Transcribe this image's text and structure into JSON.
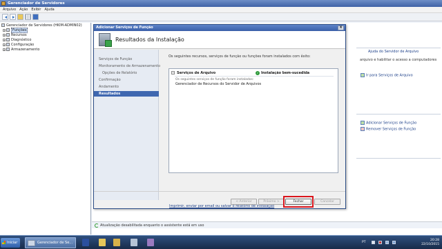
{
  "window": {
    "title": "Gerenciador de Servidores",
    "menu": [
      "Arquivo",
      "Ação",
      "Exibir",
      "Ajuda"
    ]
  },
  "tree": {
    "root": "Gerenciador de Servidores (HKIM-ADMIN02)",
    "items": [
      "Funções",
      "Recursos",
      "Diagnóstico",
      "Configuração",
      "Armazenamento"
    ]
  },
  "right_pane": {
    "help_link": "Ajuda do Servidor de Arquivo",
    "description": "arquivo e habilitar o acesso a computadores",
    "goto_link": "Ir para Serviços de Arquivo",
    "add_link": "Adicionar Serviços de Função",
    "remove_link": "Remover Serviços de Função"
  },
  "status_bar": "Atualização desabilitada enquanto o assistente está em uso",
  "dialog": {
    "title": "Adicionar Serviços de Função",
    "close_glyph": "X",
    "header": "Resultados da Instalação",
    "nav": [
      "Serviços de Função",
      "Monitoramento de Armazenamento",
      "Opções de Relatório",
      "Confirmação",
      "Andamento",
      "Resultados"
    ],
    "message": "Os seguintes recursos, serviços de função ou funções foram instalados com êxito:",
    "result": {
      "expander": "−",
      "role": "Serviços de Arquivo",
      "status": "Instalação bem-sucedida",
      "line1": "Os seguintes serviços de função foram instalados:",
      "line2": "Gerenciador de Recursos do Servidor de Arquivos"
    },
    "report_link": "Imprimir, enviar por email ou salvar o relatório de instalação",
    "buttons": {
      "previous": "< Anterior",
      "next": "Próximo >",
      "close": "Fechar",
      "cancel": "Cancelar"
    }
  },
  "taskbar": {
    "start": "Iniciar",
    "task": "Gerenciador de Se...",
    "lang": "PT",
    "time": "20:28",
    "date": "22/10/2015"
  },
  "colors": {
    "desktop": "#6d8cb6",
    "accent": "#3f67b0",
    "highlight_box": "#d9141b"
  }
}
